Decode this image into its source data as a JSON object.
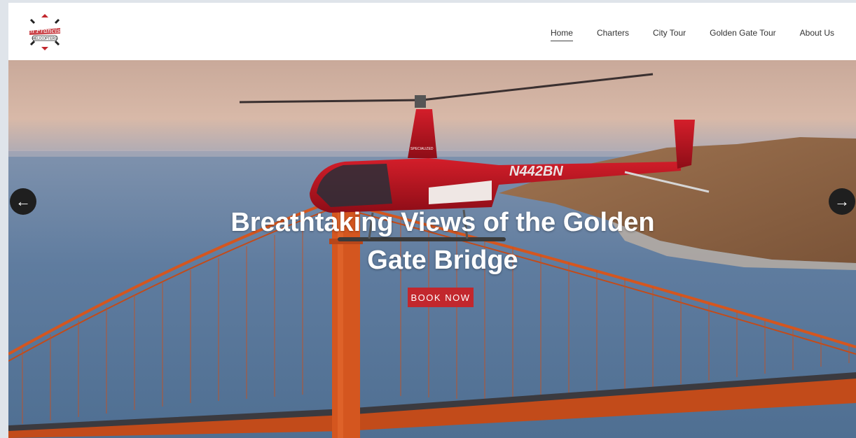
{
  "header": {
    "logo": {
      "alt": "San Francisco Helicopters",
      "line1": "San Francisco",
      "line2": "HELICOPTERS"
    },
    "nav": [
      {
        "label": "Home",
        "active": true
      },
      {
        "label": "Charters",
        "active": false
      },
      {
        "label": "City Tour",
        "active": false
      },
      {
        "label": "Golden Gate Tour",
        "active": false
      },
      {
        "label": "About Us",
        "active": false
      }
    ]
  },
  "hero": {
    "title_line1": "Breathtaking Views of the Golden",
    "title_line2": "Gate Bridge",
    "cta_label": "BOOK NOW",
    "prev_icon": "←",
    "next_icon": "→",
    "helicopter_registration": "N442BN",
    "helicopter_brand": "SPECIALIZED",
    "colors": {
      "accent": "#c2272d",
      "helicopter_red": "#b5121b",
      "bridge_orange": "#d4561f",
      "water": "#5d7c9e"
    }
  }
}
